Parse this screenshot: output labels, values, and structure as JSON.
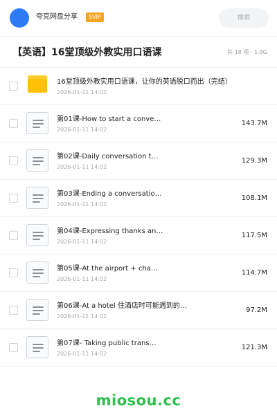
{
  "header": {
    "username": "夸克网盘分享",
    "badge": "SVIP",
    "search_placeholder": "搜索"
  },
  "title": {
    "text": "【英语】16堂顶级外教实用口语课",
    "summary": "共 18 项 · 1.9G"
  },
  "folder": {
    "name": "16堂顶级外教实用口语课，让你的英语脱口而出（完结）",
    "date": "2026-01-11 14:02"
  },
  "files": [
    {
      "name": "第01课-How to start a conve…",
      "date": "2026-01-11 14:02",
      "size": "143.7M"
    },
    {
      "name": "第02课-Daily conversation t…",
      "date": "2026-01-11 14:02",
      "size": "129.3M"
    },
    {
      "name": "第03课-Ending a conversatio…",
      "date": "2026-01-11 14:02",
      "size": "108.1M"
    },
    {
      "name": "第04课-Expressing thanks an…",
      "date": "2026-01-11 14:02",
      "size": "117.5M"
    },
    {
      "name": "第05课-At the airport + cha…",
      "date": "2026-01-11 14:02",
      "size": "114.7M"
    },
    {
      "name": "第06课-At a hotel 住酒店时可能遇到的…",
      "date": "2026-01-11 14:02",
      "size": "97.2M"
    },
    {
      "name": "第07课- Taking public trans…",
      "date": "2026-01-11 14:02",
      "size": "121.3M"
    }
  ],
  "watermark": "miosou.cc"
}
